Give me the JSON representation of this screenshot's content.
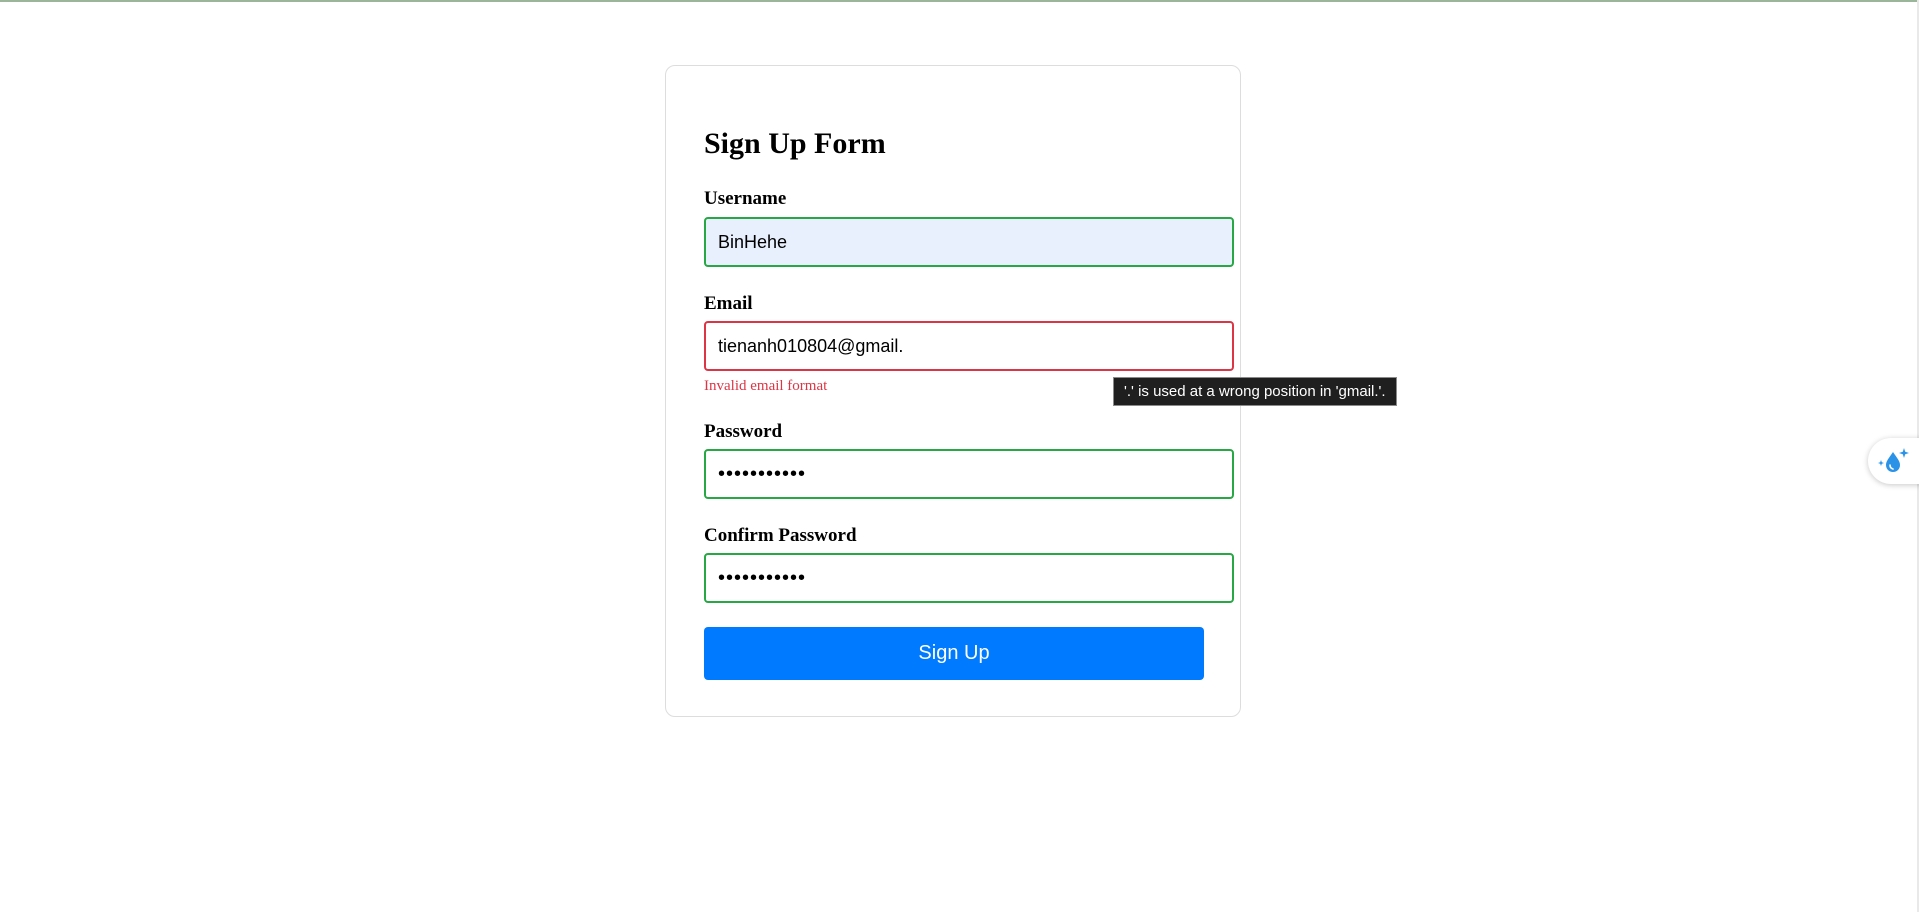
{
  "form": {
    "title": "Sign Up Form",
    "username": {
      "label": "Username",
      "value": "BinHehe"
    },
    "email": {
      "label": "Email",
      "value": "tienanh010804@gmail.",
      "error": "Invalid email format"
    },
    "password": {
      "label": "Password",
      "value": "•••••••••••"
    },
    "confirm_password": {
      "label": "Confirm Password",
      "value": "•••••••••••"
    },
    "submit_label": "Sign Up"
  },
  "tooltip": {
    "text": "'.' is used at a wrong position in 'gmail.'."
  },
  "extension": {
    "icon": "water-drop-sparkle-icon"
  },
  "colors": {
    "valid_border": "#28a745",
    "invalid_border": "#dc3545",
    "error_text": "#dc3545",
    "primary_button": "#007bff",
    "autofill_background": "#e8f0fe",
    "tooltip_background": "#1f1f1f"
  }
}
